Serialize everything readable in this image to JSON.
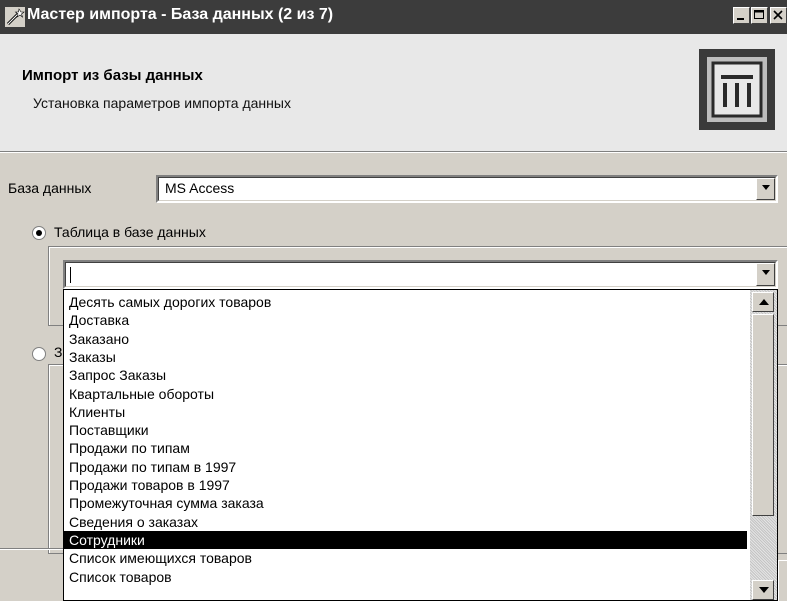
{
  "window": {
    "title": "Мастер импорта - База данных (2 из 7)"
  },
  "header": {
    "title": "Импорт из базы данных",
    "subtitle": "Установка параметров импорта данных"
  },
  "form": {
    "database_label": "База данных",
    "database_value": "MS Access",
    "radio_table_label": "Таблица в базе данных",
    "radio_table_checked": true,
    "radio_query_label": "З",
    "table_combo_value": ""
  },
  "dropdown": {
    "items": [
      "Десять самых дорогих товаров",
      "Доставка",
      "Заказано",
      "Заказы",
      "Запрос Заказы",
      "Квартальные обороты",
      "Клиенты",
      "Поставщики",
      "Продажи по типам",
      "Продажи по типам в 1997",
      "Продажи товаров в 1997",
      "Промежуточная сумма заказа",
      "Сведения о заказах",
      "Сотрудники",
      "Список имеющихся товаров",
      "Список товаров"
    ],
    "selected_index": 13
  }
}
